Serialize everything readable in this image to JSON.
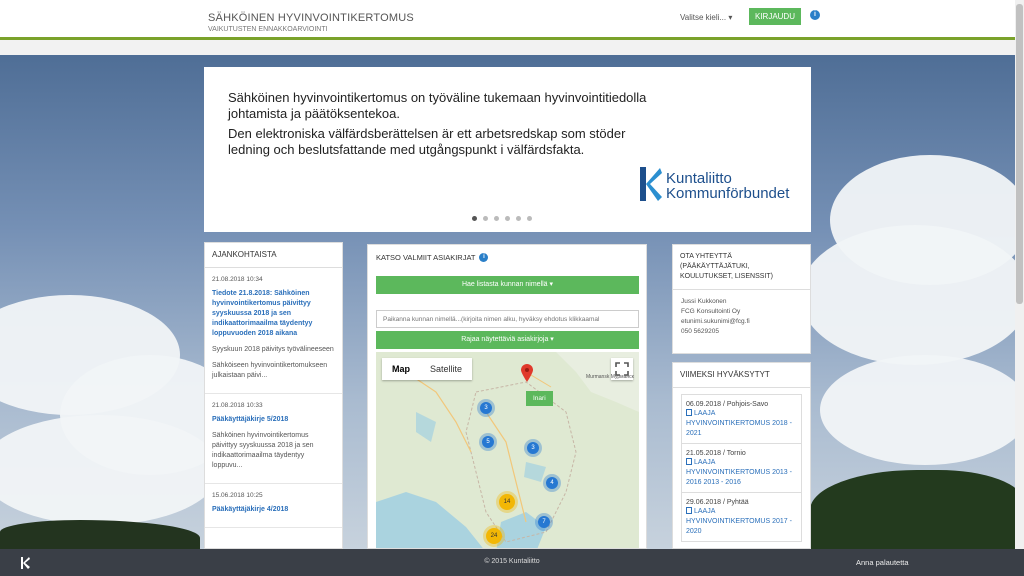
{
  "header": {
    "title": "SÄHKÖINEN HYVINVOINTIKERTOMUS",
    "subtitle": "VAIKUTUSTEN ENNAKKOARVIOINTI",
    "language": "Valitse kieli...",
    "login_label": "KIRJAUDU",
    "info_icon": "i"
  },
  "hero": {
    "text_fi": "Sähköinen hyvinvointikertomus on työväline tukemaan hyvinvointitiedolla johtamista ja päätöksentekoa.",
    "text_sv": "Den elektroniska välfärdsberättelsen är ett arbetsredskap som stöder ledning och beslutsfattande med utgångspunkt i välfärdsfakta.",
    "logo_line1": "Kuntaliitto",
    "logo_line2": "Kommunförbundet",
    "logo_color": "#1d4f8c",
    "dots": 6
  },
  "news": {
    "heading": "AJANKOHTAISTA",
    "items": [
      {
        "date": "21.08.2018 10:34",
        "title": "Tiedote 21.8.2018: Sähköinen hyvinvointikertomus päivittyy syyskuussa 2018 ja sen indikaattorimaailma täydentyy loppuvuoden 2018 aikana",
        "body1": "Syyskuun 2018 päivitys työvälineeseen",
        "body2": "Sähköiseen hyvinvointikertomukseen julkaistaan päivi..."
      },
      {
        "date": "21.08.2018 10:33",
        "title": "Pääkäyttäjäkirje 5/2018",
        "body1": "Sähköinen hyvinvointikertomus päivittyy syyskuussa 2018 ja sen indikaattorimaailma täydentyy loppuvu...",
        "body2": ""
      },
      {
        "date": "15.06.2018 10:25",
        "title": "Pääkäyttäjäkirje 4/2018",
        "body1": "",
        "body2": ""
      }
    ]
  },
  "center": {
    "heading": "KATSO VALMIIT ASIAKIRJAT",
    "search_by_name": "Hae listasta kunnan nimellä ▾",
    "search_placeholder": "Paikanna kunnan nimellä...(kirjoita nimen alku, hyväksy ehdotus klikkaamal",
    "filter_label": "Rajaa näytettäviä asiakirjoja ▾",
    "map_tab": "Map",
    "satellite_tab": "Satellite",
    "marker_label": "Inari",
    "city_label": "Murmansk\nМурманск",
    "clusters": [
      {
        "count": "3",
        "kind": "blue"
      },
      {
        "count": "5",
        "kind": "blue"
      },
      {
        "count": "3",
        "kind": "blue"
      },
      {
        "count": "4",
        "kind": "blue"
      },
      {
        "count": "14",
        "kind": "yellow"
      },
      {
        "count": "7",
        "kind": "blue"
      },
      {
        "count": "24",
        "kind": "yellow"
      }
    ]
  },
  "contact": {
    "heading": "OTA YHTEYTTÄ (PÄÄKÄYTTÄJÄTUKI, KOULUTUKSET, LISENSSIT)",
    "name": "Jussi Kukkonen",
    "company": "FCG Konsultointi Oy",
    "email": "etunimi.sukunimi@fcg.fi",
    "phone": "050 5629205"
  },
  "recent": {
    "heading": "VIIMEKSI HYVÄKSYTYT",
    "items": [
      {
        "meta": "06.09.2018 / Pohjois-Savo",
        "link": "LAAJA HYVINVOINTIKERTOMUS 2018 - 2021"
      },
      {
        "meta": "21.05.2018 / Tornio",
        "link": "LAAJA HYVINVOINTIKERTOMUS 2013 - 2016 2013 - 2016"
      },
      {
        "meta": "29.06.2018 / Pyhtää",
        "link": "LAAJA HYVINVOINTIKERTOMUS 2017 - 2020"
      }
    ]
  },
  "footer": {
    "copyright": "© 2015 Kuntaliitto",
    "feedback": "Anna palautetta"
  },
  "colors": {
    "accent_green": "#5cb85c",
    "link_blue": "#2a6fba",
    "header_line": "#7aa22a",
    "footer_bg": "#3a3f47"
  }
}
